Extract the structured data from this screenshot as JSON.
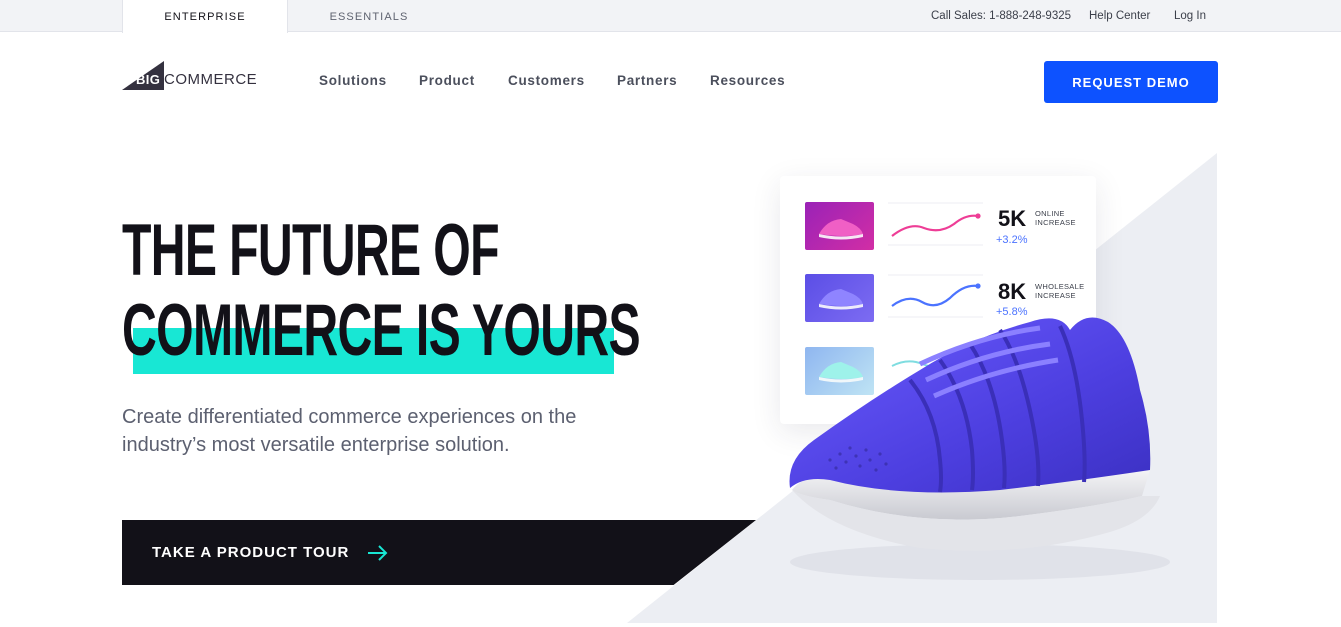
{
  "topbar": {
    "tabs": [
      {
        "label": "ENTERPRISE",
        "active": true
      },
      {
        "label": "ESSENTIALS",
        "active": false
      }
    ],
    "call_sales": "Call Sales: 1-888-248-9325",
    "help_center": "Help Center",
    "login": "Log In"
  },
  "header": {
    "logo": {
      "big": "BIG",
      "commerce": "COMMERCE"
    },
    "nav": [
      "Solutions",
      "Product",
      "Customers",
      "Partners",
      "Resources"
    ],
    "cta": "REQUEST DEMO"
  },
  "hero": {
    "headline_line1": "THE FUTURE OF",
    "headline_line2": "COMMERCE IS YOURS",
    "subcopy": "Create differentiated commerce experiences on the industry’s most versatile enterprise solution.",
    "tour_button": "TAKE A PRODUCT TOUR",
    "tour_icon": "arrow-right-icon"
  },
  "stats": [
    {
      "value": "5K",
      "label": "ONLINE INCREASE",
      "change": "+3.2%"
    },
    {
      "value": "8K",
      "label": "WHOLESALE INCREASE",
      "change": "+5.8%"
    }
  ],
  "colors": {
    "accent_blue": "#0d52ff",
    "highlight_teal": "#18e7d4",
    "dark": "#121118",
    "shoe_blue": "#5a4cf0"
  }
}
